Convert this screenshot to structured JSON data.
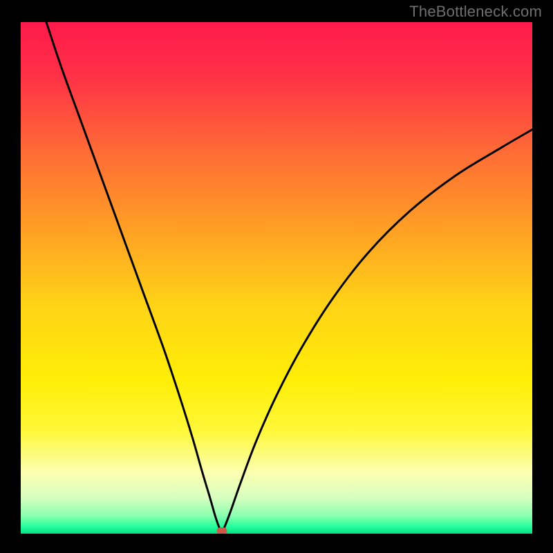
{
  "watermark": "TheBottleneck.com",
  "chart_data": {
    "type": "line",
    "title": "",
    "xlabel": "",
    "ylabel": "",
    "xlim": [
      0,
      100
    ],
    "ylim": [
      0,
      100
    ],
    "gradient_stops": [
      {
        "pos": 0.0,
        "color": "#ff1a4b"
      },
      {
        "pos": 0.1,
        "color": "#ff2f47"
      },
      {
        "pos": 0.25,
        "color": "#ff6a36"
      },
      {
        "pos": 0.4,
        "color": "#ff9e25"
      },
      {
        "pos": 0.55,
        "color": "#ffd217"
      },
      {
        "pos": 0.7,
        "color": "#ffee07"
      },
      {
        "pos": 0.8,
        "color": "#fff83a"
      },
      {
        "pos": 0.88,
        "color": "#fbffb0"
      },
      {
        "pos": 0.93,
        "color": "#d8ffc0"
      },
      {
        "pos": 0.965,
        "color": "#8affb0"
      },
      {
        "pos": 0.985,
        "color": "#2bff9d"
      },
      {
        "pos": 1.0,
        "color": "#00e184"
      }
    ],
    "series": [
      {
        "name": "bottleneck-curve",
        "x": [
          5,
          8,
          12,
          16,
          20,
          24,
          28,
          31,
          33.5,
          35.5,
          37,
          38,
          38.8,
          39.3,
          39.3,
          39.8,
          41,
          43,
          46,
          50,
          55,
          61,
          68,
          76,
          85,
          94,
          100
        ],
        "y": [
          100,
          91,
          80,
          69,
          58,
          47,
          36,
          27,
          19,
          12,
          7,
          3.5,
          1.2,
          0.3,
          0.3,
          1.2,
          4.3,
          10,
          18,
          27,
          36.5,
          46,
          55,
          63,
          70,
          75.5,
          79
        ]
      }
    ],
    "marker": {
      "x": 39.3,
      "y": 0.6,
      "color": "#d05a4a"
    }
  }
}
